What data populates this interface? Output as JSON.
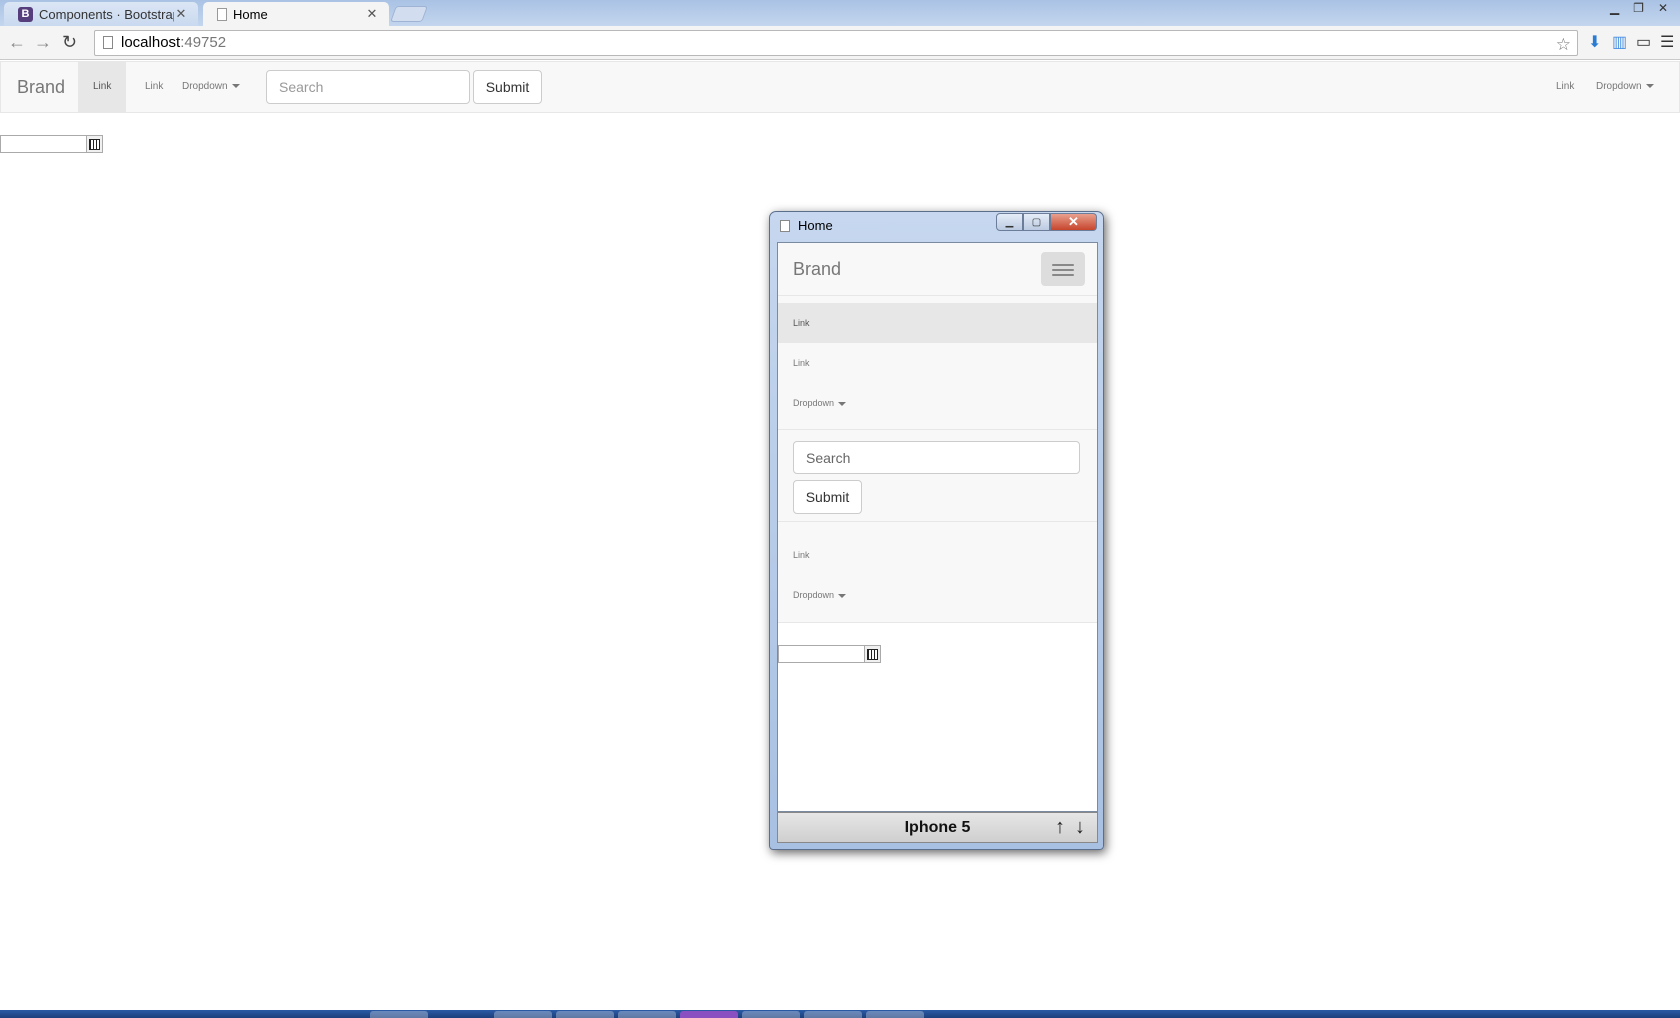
{
  "browser": {
    "tabs": [
      {
        "label": "Components · Bootstrap",
        "favicon": "B"
      },
      {
        "label": "Home"
      }
    ],
    "url_host": "localhost",
    "url_port": ":49752"
  },
  "navbar": {
    "brand": "Brand",
    "left_links": [
      "Link",
      "Link",
      "Dropdown"
    ],
    "search_placeholder": "Search",
    "submit_label": "Submit",
    "right_links": [
      "Link",
      "Dropdown"
    ]
  },
  "emulator": {
    "window_title": "Home",
    "brand": "Brand",
    "links": [
      "Link",
      "Link",
      "Dropdown"
    ],
    "search_placeholder": "Search",
    "submit_label": "Submit",
    "links2": [
      "Link",
      "Dropdown"
    ],
    "device_label": "Iphone 5",
    "arrow_up": "↑",
    "arrow_down": "↓"
  },
  "colors": {
    "navbar_bg": "#f8f8f8",
    "active_link_bg": "#e7e7e7",
    "bootstrap_purple": "#563d7c"
  }
}
